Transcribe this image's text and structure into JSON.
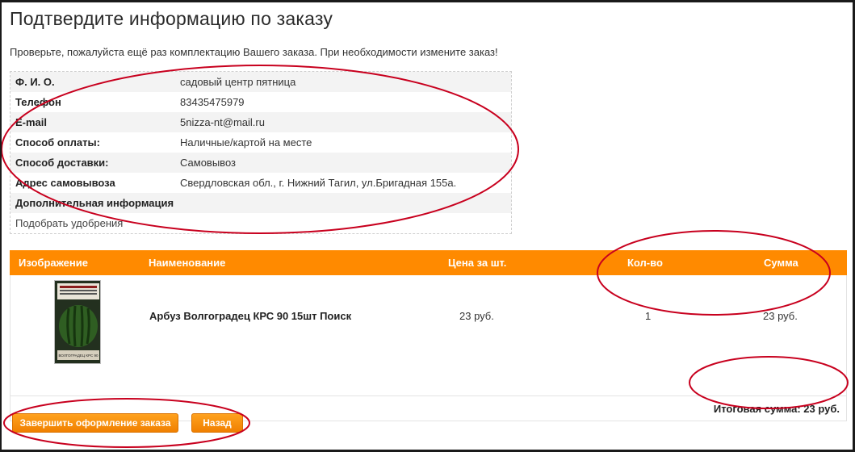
{
  "page": {
    "title": "Подтвердите информацию по заказу",
    "intro": "Проверьте, пожалуйста ещё раз комплектацию Вашего заказа. При необходимости измените заказ!"
  },
  "info": {
    "fio_label": "Ф. И. О.",
    "fio_value": "садовый центр пятница",
    "phone_label": "Телефон",
    "phone_value": "83435475979",
    "email_label": "E-mail",
    "email_value": "5nizza-nt@mail.ru",
    "payment_label": "Способ оплаты:",
    "payment_value": "Наличные/картой на месте",
    "delivery_label": "Способ доставки:",
    "delivery_value": "Самовывоз",
    "pickup_label": "Адрес самовывоза",
    "pickup_value": "Свердловская обл., г. Нижний Тагил, ул.Бригадная 155а.",
    "extra_label": "Дополнительная информация",
    "extra_value": "Подобрать удобрения"
  },
  "products": {
    "headers": {
      "image": "Изображение",
      "name": "Наименование",
      "price": "Цена за шт.",
      "qty": "Кол-во",
      "sum": "Сумма"
    },
    "items": [
      {
        "name": "Арбуз Волгоградец КРС 90 15шт Поиск",
        "price": "23 руб.",
        "qty": "1",
        "sum": "23 руб.",
        "package_text": "ВОЛГОГРАДЕЦ КРС 90"
      }
    ],
    "total": "Итоговая сумма: 23 руб."
  },
  "buttons": {
    "finish": "Завершить оформление заказа",
    "back": "Назад"
  },
  "colors": {
    "accent": "#ff8a00",
    "annotation": "#c8001e"
  }
}
